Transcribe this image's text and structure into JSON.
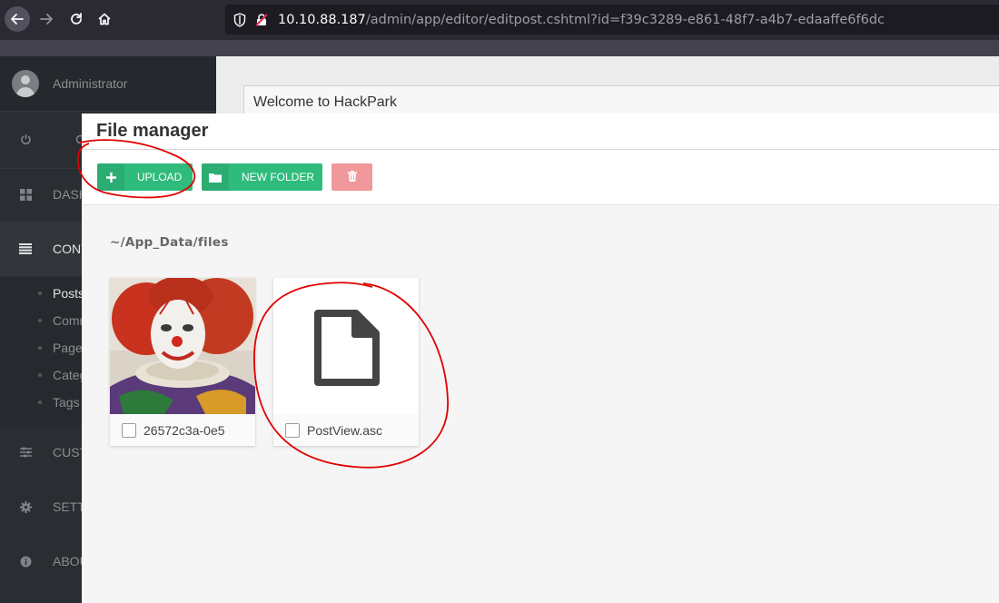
{
  "browser": {
    "url_host": "10.10.88.187",
    "url_path": "/admin/app/editor/editpost.cshtml?id=f39c3289-e861-48f7-a4b7-edaaffe6f6dc"
  },
  "sidebar": {
    "username": "Administrator",
    "items": [
      {
        "label": "DASH",
        "icon": "dashboard-icon"
      },
      {
        "label": "CONT",
        "icon": "list-icon"
      },
      {
        "label": "CUST",
        "icon": "sliders-icon"
      },
      {
        "label": "SETT",
        "icon": "gear-icon"
      },
      {
        "label": "ABOU",
        "icon": "info-icon"
      }
    ],
    "subitems": [
      "Posts",
      "Comm",
      "Page",
      "Categ",
      "Tags"
    ]
  },
  "editor": {
    "post_title": "Welcome to HackPark"
  },
  "file_manager": {
    "title": "File manager",
    "upload_label": "UPLOAD",
    "new_folder_label": "NEW FOLDER",
    "path": "~/App_Data/files",
    "files": [
      {
        "name": "26572c3a-0e5",
        "type": "image"
      },
      {
        "name": "PostView.asc",
        "type": "document"
      }
    ]
  },
  "colors": {
    "accent_green": "#2fbb7c",
    "danger_pink": "#f0989b",
    "annotation_red": "#e00000"
  }
}
